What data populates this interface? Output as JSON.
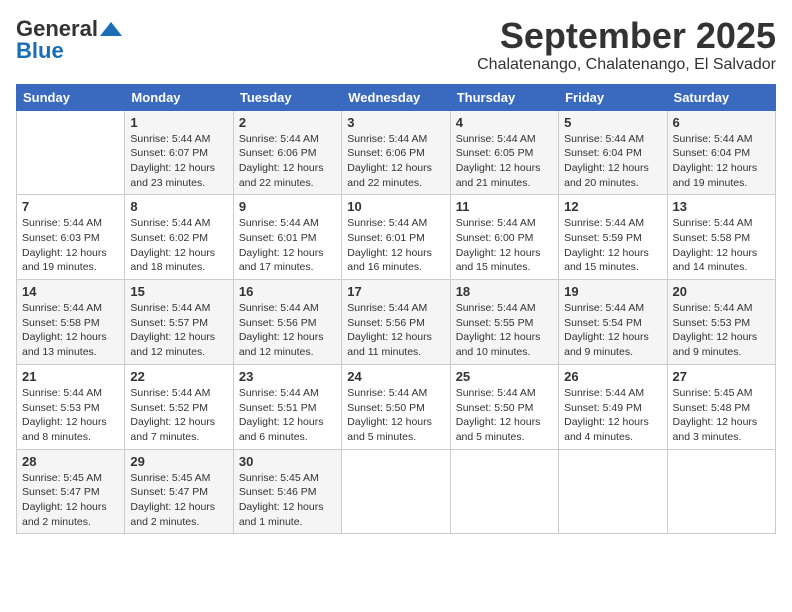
{
  "header": {
    "logo_general": "General",
    "logo_blue": "Blue",
    "month": "September 2025",
    "location": "Chalatenango, Chalatenango, El Salvador"
  },
  "weekdays": [
    "Sunday",
    "Monday",
    "Tuesday",
    "Wednesday",
    "Thursday",
    "Friday",
    "Saturday"
  ],
  "weeks": [
    [
      {
        "day": "",
        "info": ""
      },
      {
        "day": "1",
        "info": "Sunrise: 5:44 AM\nSunset: 6:07 PM\nDaylight: 12 hours\nand 23 minutes."
      },
      {
        "day": "2",
        "info": "Sunrise: 5:44 AM\nSunset: 6:06 PM\nDaylight: 12 hours\nand 22 minutes."
      },
      {
        "day": "3",
        "info": "Sunrise: 5:44 AM\nSunset: 6:06 PM\nDaylight: 12 hours\nand 22 minutes."
      },
      {
        "day": "4",
        "info": "Sunrise: 5:44 AM\nSunset: 6:05 PM\nDaylight: 12 hours\nand 21 minutes."
      },
      {
        "day": "5",
        "info": "Sunrise: 5:44 AM\nSunset: 6:04 PM\nDaylight: 12 hours\nand 20 minutes."
      },
      {
        "day": "6",
        "info": "Sunrise: 5:44 AM\nSunset: 6:04 PM\nDaylight: 12 hours\nand 19 minutes."
      }
    ],
    [
      {
        "day": "7",
        "info": "Sunrise: 5:44 AM\nSunset: 6:03 PM\nDaylight: 12 hours\nand 19 minutes."
      },
      {
        "day": "8",
        "info": "Sunrise: 5:44 AM\nSunset: 6:02 PM\nDaylight: 12 hours\nand 18 minutes."
      },
      {
        "day": "9",
        "info": "Sunrise: 5:44 AM\nSunset: 6:01 PM\nDaylight: 12 hours\nand 17 minutes."
      },
      {
        "day": "10",
        "info": "Sunrise: 5:44 AM\nSunset: 6:01 PM\nDaylight: 12 hours\nand 16 minutes."
      },
      {
        "day": "11",
        "info": "Sunrise: 5:44 AM\nSunset: 6:00 PM\nDaylight: 12 hours\nand 15 minutes."
      },
      {
        "day": "12",
        "info": "Sunrise: 5:44 AM\nSunset: 5:59 PM\nDaylight: 12 hours\nand 15 minutes."
      },
      {
        "day": "13",
        "info": "Sunrise: 5:44 AM\nSunset: 5:58 PM\nDaylight: 12 hours\nand 14 minutes."
      }
    ],
    [
      {
        "day": "14",
        "info": "Sunrise: 5:44 AM\nSunset: 5:58 PM\nDaylight: 12 hours\nand 13 minutes."
      },
      {
        "day": "15",
        "info": "Sunrise: 5:44 AM\nSunset: 5:57 PM\nDaylight: 12 hours\nand 12 minutes."
      },
      {
        "day": "16",
        "info": "Sunrise: 5:44 AM\nSunset: 5:56 PM\nDaylight: 12 hours\nand 12 minutes."
      },
      {
        "day": "17",
        "info": "Sunrise: 5:44 AM\nSunset: 5:56 PM\nDaylight: 12 hours\nand 11 minutes."
      },
      {
        "day": "18",
        "info": "Sunrise: 5:44 AM\nSunset: 5:55 PM\nDaylight: 12 hours\nand 10 minutes."
      },
      {
        "day": "19",
        "info": "Sunrise: 5:44 AM\nSunset: 5:54 PM\nDaylight: 12 hours\nand 9 minutes."
      },
      {
        "day": "20",
        "info": "Sunrise: 5:44 AM\nSunset: 5:53 PM\nDaylight: 12 hours\nand 9 minutes."
      }
    ],
    [
      {
        "day": "21",
        "info": "Sunrise: 5:44 AM\nSunset: 5:53 PM\nDaylight: 12 hours\nand 8 minutes."
      },
      {
        "day": "22",
        "info": "Sunrise: 5:44 AM\nSunset: 5:52 PM\nDaylight: 12 hours\nand 7 minutes."
      },
      {
        "day": "23",
        "info": "Sunrise: 5:44 AM\nSunset: 5:51 PM\nDaylight: 12 hours\nand 6 minutes."
      },
      {
        "day": "24",
        "info": "Sunrise: 5:44 AM\nSunset: 5:50 PM\nDaylight: 12 hours\nand 5 minutes."
      },
      {
        "day": "25",
        "info": "Sunrise: 5:44 AM\nSunset: 5:50 PM\nDaylight: 12 hours\nand 5 minutes."
      },
      {
        "day": "26",
        "info": "Sunrise: 5:44 AM\nSunset: 5:49 PM\nDaylight: 12 hours\nand 4 minutes."
      },
      {
        "day": "27",
        "info": "Sunrise: 5:45 AM\nSunset: 5:48 PM\nDaylight: 12 hours\nand 3 minutes."
      }
    ],
    [
      {
        "day": "28",
        "info": "Sunrise: 5:45 AM\nSunset: 5:47 PM\nDaylight: 12 hours\nand 2 minutes."
      },
      {
        "day": "29",
        "info": "Sunrise: 5:45 AM\nSunset: 5:47 PM\nDaylight: 12 hours\nand 2 minutes."
      },
      {
        "day": "30",
        "info": "Sunrise: 5:45 AM\nSunset: 5:46 PM\nDaylight: 12 hours\nand 1 minute."
      },
      {
        "day": "",
        "info": ""
      },
      {
        "day": "",
        "info": ""
      },
      {
        "day": "",
        "info": ""
      },
      {
        "day": "",
        "info": ""
      }
    ]
  ]
}
